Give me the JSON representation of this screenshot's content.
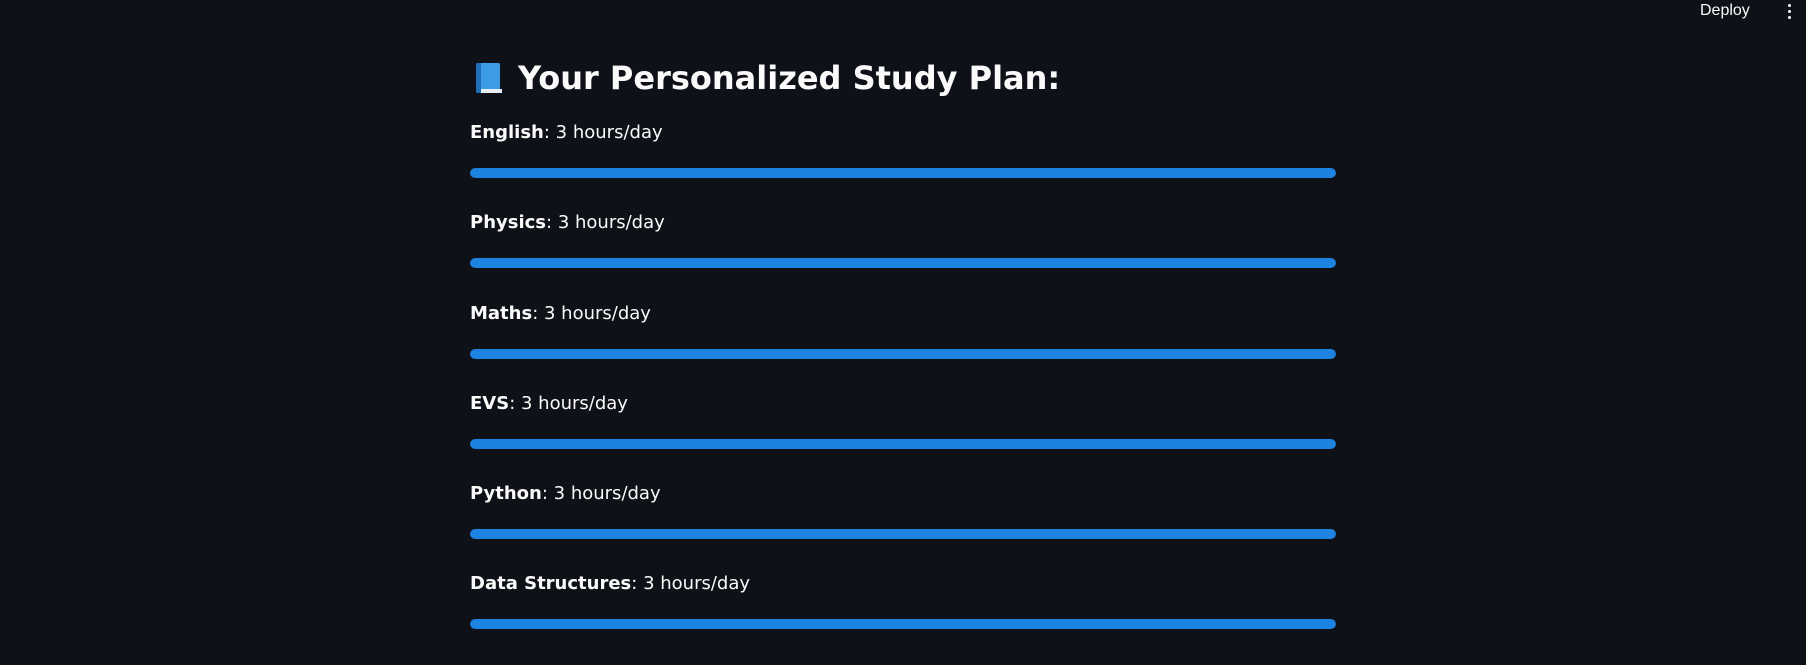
{
  "header": {
    "deploy_label": "Deploy"
  },
  "page": {
    "icon": "blue-book-icon",
    "title": "Your Personalized Study Plan:"
  },
  "colors": {
    "background": "#0e1117",
    "progress_fill": "#1c83e1",
    "text": "#fafafa"
  },
  "subjects": [
    {
      "name": "English",
      "sep": ": ",
      "hours": "3 hours/day",
      "progress": 1.0
    },
    {
      "name": "Physics",
      "sep": ": ",
      "hours": "3 hours/day",
      "progress": 1.0
    },
    {
      "name": "Maths",
      "sep": ": ",
      "hours": "3 hours/day",
      "progress": 1.0
    },
    {
      "name": "EVS",
      "sep": ": ",
      "hours": "3 hours/day",
      "progress": 1.0
    },
    {
      "name": "Python",
      "sep": ": ",
      "hours": "3 hours/day",
      "progress": 1.0
    },
    {
      "name": "Data Structures",
      "sep": ": ",
      "hours": "3 hours/day",
      "progress": 1.0
    }
  ]
}
